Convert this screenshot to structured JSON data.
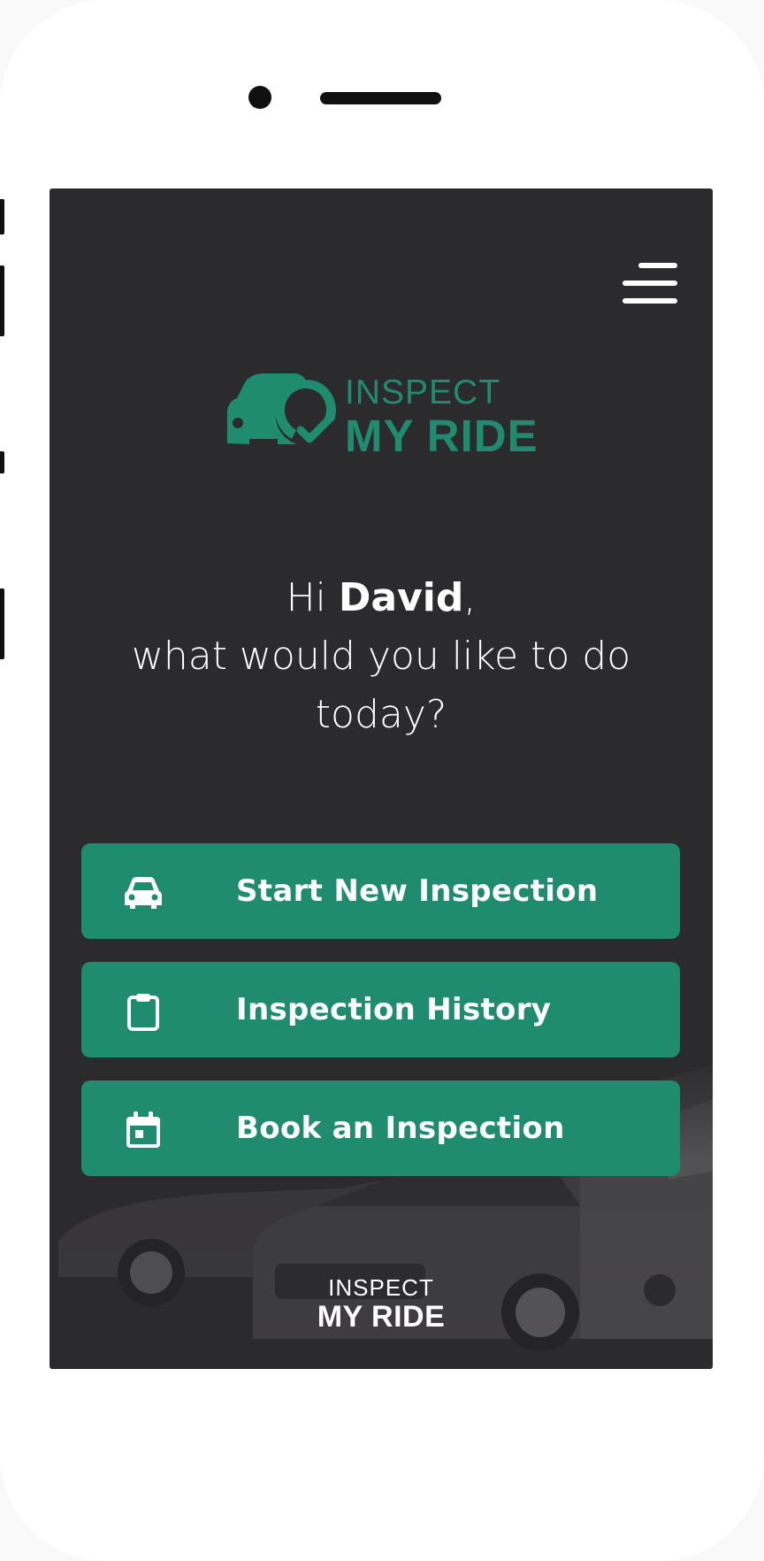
{
  "app": {
    "brand_line1": "INSPECT",
    "brand_line2": "MY RIDE"
  },
  "header": {
    "menu_icon": "hamburger-menu-icon"
  },
  "greeting": {
    "hi": "Hi",
    "name": "David",
    "comma": ",",
    "question": "what would you like to do today?"
  },
  "actions": [
    {
      "label": "Start New Inspection",
      "icon": "car-icon"
    },
    {
      "label": "Inspection History",
      "icon": "clipboard-icon"
    },
    {
      "label": "Book an Inspection",
      "icon": "calendar-icon"
    }
  ],
  "footer": {
    "brand_line1": "INSPECT",
    "brand_line2": "MY RIDE"
  },
  "colors": {
    "accent": "#1f8c70",
    "screen_background": "#2b2a2c",
    "text": "#ffffff"
  }
}
